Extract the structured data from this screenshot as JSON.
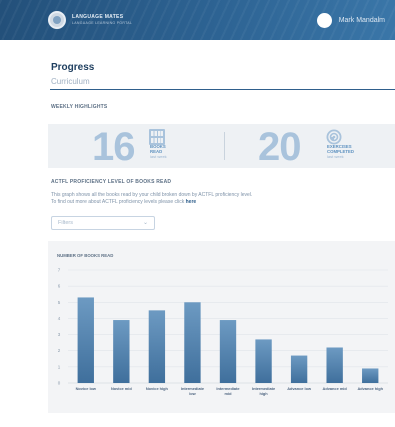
{
  "header": {
    "logo_line1": "LANGUAGE MATES",
    "logo_line2": "LANGUAGE LEARNING PORTAL",
    "user_name": "Mark Mandalm"
  },
  "page": {
    "title": "Progress",
    "subtitle": "Curriculum"
  },
  "highlights": {
    "section_label": "WEEKLY HIGHLIGHTS",
    "books": {
      "count": "16",
      "label_line1": "BOOKS",
      "label_line2": "READ",
      "caption": "last week",
      "icon": "books-icon"
    },
    "exercises": {
      "count": "20",
      "label_line1": "EXERCISES",
      "label_line2": "COMPLETED",
      "caption": "last week",
      "icon": "exercise-icon"
    }
  },
  "proficiency": {
    "section_label": "ACTFL PROFICIENCY LEVEL OF BOOKS READ",
    "description_line1": "This graph shows all the books read by your child broken down by ACTFL proficiency level.",
    "description_line2_prefix": "To find out more about ACTFL proficiency levels please click",
    "description_link": "here",
    "filter_placeholder": "Filters"
  },
  "colors": {
    "bar_top": "#6d9ac2",
    "bar_bottom": "#3f6f9c",
    "accent": "#2f5f8c"
  },
  "chart_data": {
    "type": "bar",
    "title": "NUMBER OF BOOKS READ",
    "categories": [
      [
        "Novice low"
      ],
      [
        "Novice mid"
      ],
      [
        "Novice high"
      ],
      [
        "Intermediate",
        "low"
      ],
      [
        "Intermediate",
        "mid"
      ],
      [
        "Intermediate",
        "high"
      ],
      [
        "Advance low"
      ],
      [
        "Advance mid"
      ],
      [
        "Advance high"
      ]
    ],
    "values": [
      5.3,
      3.9,
      4.5,
      5.0,
      3.9,
      2.7,
      1.7,
      2.2,
      0.9
    ],
    "ylim": [
      0,
      7
    ],
    "yticks": [
      0,
      1,
      2,
      3,
      4,
      5,
      6,
      7
    ],
    "grid": true
  }
}
